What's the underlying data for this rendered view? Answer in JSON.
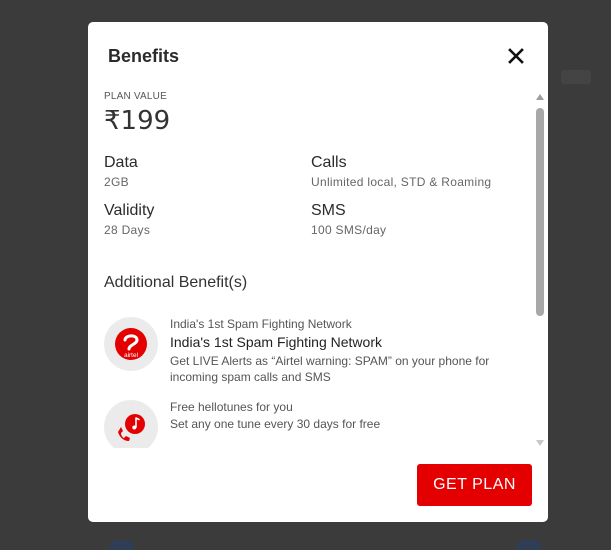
{
  "modal": {
    "title": "Benefits",
    "close_icon": "close-icon",
    "plan_value_label": "PLAN VALUE",
    "plan_value": "₹199",
    "data_label": "Data",
    "data_value": "2GB",
    "calls_label": "Calls",
    "calls_value": "Unlimited local, STD & Roaming",
    "validity_label": "Validity",
    "validity_value": "28 Days",
    "sms_label": "SMS",
    "sms_value": "100 SMS/day",
    "additional_title": "Additional Benefit(s)",
    "benefits": [
      {
        "icon": "airtel-logo-icon",
        "logo_text": "airtel",
        "kicker": "India's 1st Spam Fighting Network",
        "title": "India's 1st Spam Fighting Network",
        "description": "Get LIVE Alerts as “Airtel warning: SPAM” on your phone for incoming spam calls and SMS"
      },
      {
        "icon": "hellotunes-icon",
        "kicker": "Free hellotunes for you",
        "title": "",
        "description": "Set any one tune every 30 days for free"
      }
    ],
    "get_plan_label": "GET PLAN"
  },
  "colors": {
    "accent": "#e40000",
    "backdrop": "#3b3b3b"
  }
}
